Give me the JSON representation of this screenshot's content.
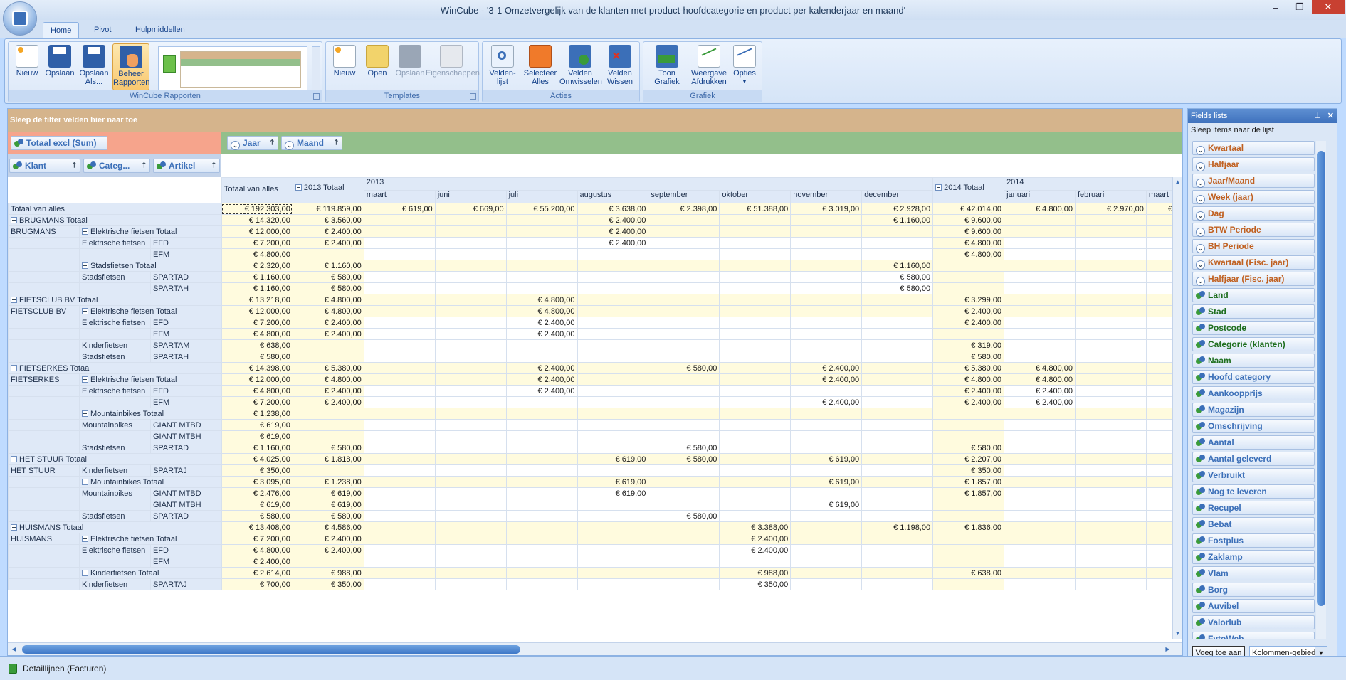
{
  "window": {
    "title": "WinCube - '3-1 Omzetvergelijk van de klanten met product-hoofdcategorie en product per kalenderjaar en maand'"
  },
  "tabs": [
    "Home",
    "Pivot",
    "Hulpmiddellen"
  ],
  "ribbon": {
    "groups": {
      "rapporten": "WinCube Rapporten",
      "templates": "Templates",
      "acties": "Acties",
      "grafiek": "Grafiek"
    },
    "buttons": {
      "nieuw": "Nieuw",
      "opslaan": "Opslaan",
      "opslaan_als": "Opslaan Als...",
      "beheer": "Beheer Rapporten",
      "t_nieuw": "Nieuw",
      "t_open": "Open",
      "t_opslaan": "Opslaan",
      "t_eigen": "Eigenschappen",
      "velden_lijst": "Velden-lijst",
      "selecteer_alles": "Selecteer Alles",
      "velden_omwisselen": "Velden Omwisselen",
      "velden_wissen": "Velden Wissen",
      "toon_grafiek": "Toon Grafiek",
      "weergave": "Weergave Afdrukken",
      "opties": "Opties"
    }
  },
  "pivot": {
    "filter_zone": "Sleep de filter velden hier naar toe",
    "data_field": "Totaal excl (Sum)",
    "col_fields": [
      "Jaar",
      "Maand"
    ],
    "row_fields": [
      "Klant",
      "Categ...",
      "Artikel"
    ],
    "headers": {
      "grand": "Totaal van alles",
      "y2013": "2013",
      "y2013_total": "2013 Totaal",
      "y2014": "2014",
      "y2014_total": "2014 Totaal",
      "months2013": [
        "maart",
        "juni",
        "juli",
        "augustus",
        "september",
        "oktober",
        "november",
        "december"
      ],
      "months2014": [
        "januari",
        "februari",
        "maart"
      ]
    },
    "rows": [
      {
        "type": "grand",
        "c1": "Totaal van alles",
        "c2": "",
        "c3": "",
        "vals": [
          "€ 192.303,00",
          "€ 119.859,00",
          "€ 619,00",
          "€ 669,00",
          "€ 55.200,00",
          "€ 3.638,00",
          "€ 2.398,00",
          "€ 51.388,00",
          "€ 3.019,00",
          "€ 2.928,00",
          "€ 42.014,00",
          "€ 4.800,00",
          "€ 2.970,00",
          "€"
        ]
      },
      {
        "type": "ctot",
        "c1": "BRUGMANS Totaal",
        "c2": "",
        "c3": "",
        "vals": [
          "€ 14.320,00",
          "€ 3.560,00",
          "",
          "",
          "",
          "€ 2.400,00",
          "",
          "",
          "",
          "€ 1.160,00",
          "€ 9.600,00",
          "",
          "",
          ""
        ]
      },
      {
        "type": "stot",
        "c1": "BRUGMANS",
        "c2": "Elektrische fietsen Totaal",
        "c3": "",
        "vals": [
          "€ 12.000,00",
          "€ 2.400,00",
          "",
          "",
          "",
          "€ 2.400,00",
          "",
          "",
          "",
          "",
          "€ 9.600,00",
          "",
          "",
          ""
        ]
      },
      {
        "type": "d",
        "c1": "",
        "c2": "Elektrische fietsen",
        "c3": "EFD",
        "vals": [
          "€ 7.200,00",
          "€ 2.400,00",
          "",
          "",
          "",
          "€ 2.400,00",
          "",
          "",
          "",
          "",
          "€ 4.800,00",
          "",
          "",
          ""
        ]
      },
      {
        "type": "d",
        "c1": "",
        "c2": "",
        "c3": "EFM",
        "vals": [
          "€ 4.800,00",
          "",
          "",
          "",
          "",
          "",
          "",
          "",
          "",
          "",
          "€ 4.800,00",
          "",
          "",
          ""
        ]
      },
      {
        "type": "stot",
        "c1": "",
        "c2": "Stadsfietsen Totaal",
        "c3": "",
        "vals": [
          "€ 2.320,00",
          "€ 1.160,00",
          "",
          "",
          "",
          "",
          "",
          "",
          "",
          "€ 1.160,00",
          "",
          "",
          "",
          ""
        ]
      },
      {
        "type": "d",
        "c1": "",
        "c2": "Stadsfietsen",
        "c3": "SPARTAD",
        "vals": [
          "€ 1.160,00",
          "€ 580,00",
          "",
          "",
          "",
          "",
          "",
          "",
          "",
          "€ 580,00",
          "",
          "",
          "",
          ""
        ]
      },
      {
        "type": "d",
        "c1": "",
        "c2": "",
        "c3": "SPARTAH",
        "vals": [
          "€ 1.160,00",
          "€ 580,00",
          "",
          "",
          "",
          "",
          "",
          "",
          "",
          "€ 580,00",
          "",
          "",
          "",
          ""
        ]
      },
      {
        "type": "ctot",
        "c1": "FIETSCLUB BV Totaal",
        "c2": "",
        "c3": "",
        "vals": [
          "€ 13.218,00",
          "€ 4.800,00",
          "",
          "",
          "€ 4.800,00",
          "",
          "",
          "",
          "",
          "",
          "€ 3.299,00",
          "",
          "",
          ""
        ]
      },
      {
        "type": "stot",
        "c1": "FIETSCLUB BV",
        "c2": "Elektrische fietsen Totaal",
        "c3": "",
        "vals": [
          "€ 12.000,00",
          "€ 4.800,00",
          "",
          "",
          "€ 4.800,00",
          "",
          "",
          "",
          "",
          "",
          "€ 2.400,00",
          "",
          "",
          ""
        ]
      },
      {
        "type": "d",
        "c1": "",
        "c2": "Elektrische fietsen",
        "c3": "EFD",
        "vals": [
          "€ 7.200,00",
          "€ 2.400,00",
          "",
          "",
          "€ 2.400,00",
          "",
          "",
          "",
          "",
          "",
          "€ 2.400,00",
          "",
          "",
          ""
        ]
      },
      {
        "type": "d",
        "c1": "",
        "c2": "",
        "c3": "EFM",
        "vals": [
          "€ 4.800,00",
          "€ 2.400,00",
          "",
          "",
          "€ 2.400,00",
          "",
          "",
          "",
          "",
          "",
          "",
          "",
          "",
          ""
        ]
      },
      {
        "type": "d",
        "c1": "",
        "c2": "Kinderfietsen",
        "c3": "SPARTAM",
        "vals": [
          "€ 638,00",
          "",
          "",
          "",
          "",
          "",
          "",
          "",
          "",
          "",
          "€ 319,00",
          "",
          "",
          ""
        ]
      },
      {
        "type": "d",
        "c1": "",
        "c2": "Stadsfietsen",
        "c3": "SPARTAH",
        "vals": [
          "€ 580,00",
          "",
          "",
          "",
          "",
          "",
          "",
          "",
          "",
          "",
          "€ 580,00",
          "",
          "",
          ""
        ]
      },
      {
        "type": "ctot",
        "c1": "FIETSERKES Totaal",
        "c2": "",
        "c3": "",
        "vals": [
          "€ 14.398,00",
          "€ 5.380,00",
          "",
          "",
          "€ 2.400,00",
          "",
          "€ 580,00",
          "",
          "€ 2.400,00",
          "",
          "€ 5.380,00",
          "€ 4.800,00",
          "",
          ""
        ]
      },
      {
        "type": "stot",
        "c1": "FIETSERKES",
        "c2": "Elektrische fietsen Totaal",
        "c3": "",
        "vals": [
          "€ 12.000,00",
          "€ 4.800,00",
          "",
          "",
          "€ 2.400,00",
          "",
          "",
          "",
          "€ 2.400,00",
          "",
          "€ 4.800,00",
          "€ 4.800,00",
          "",
          ""
        ]
      },
      {
        "type": "d",
        "c1": "",
        "c2": "Elektrische fietsen",
        "c3": "EFD",
        "vals": [
          "€ 4.800,00",
          "€ 2.400,00",
          "",
          "",
          "€ 2.400,00",
          "",
          "",
          "",
          "",
          "",
          "€ 2.400,00",
          "€ 2.400,00",
          "",
          ""
        ]
      },
      {
        "type": "d",
        "c1": "",
        "c2": "",
        "c3": "EFM",
        "vals": [
          "€ 7.200,00",
          "€ 2.400,00",
          "",
          "",
          "",
          "",
          "",
          "",
          "€ 2.400,00",
          "",
          "€ 2.400,00",
          "€ 2.400,00",
          "",
          ""
        ]
      },
      {
        "type": "stot",
        "c1": "",
        "c2": "Mountainbikes Totaal",
        "c3": "",
        "vals": [
          "€ 1.238,00",
          "",
          "",
          "",
          "",
          "",
          "",
          "",
          "",
          "",
          "",
          "",
          "",
          ""
        ]
      },
      {
        "type": "d",
        "c1": "",
        "c2": "Mountainbikes",
        "c3": "GIANT MTBD",
        "vals": [
          "€ 619,00",
          "",
          "",
          "",
          "",
          "",
          "",
          "",
          "",
          "",
          "",
          "",
          "",
          ""
        ]
      },
      {
        "type": "d",
        "c1": "",
        "c2": "",
        "c3": "GIANT MTBH",
        "vals": [
          "€ 619,00",
          "",
          "",
          "",
          "",
          "",
          "",
          "",
          "",
          "",
          "",
          "",
          "",
          ""
        ]
      },
      {
        "type": "d",
        "c1": "",
        "c2": "Stadsfietsen",
        "c3": "SPARTAD",
        "vals": [
          "€ 1.160,00",
          "€ 580,00",
          "",
          "",
          "",
          "",
          "€ 580,00",
          "",
          "",
          "",
          "€ 580,00",
          "",
          "",
          ""
        ]
      },
      {
        "type": "ctot",
        "c1": "HET STUUR Totaal",
        "c2": "",
        "c3": "",
        "vals": [
          "€ 4.025,00",
          "€ 1.818,00",
          "",
          "",
          "",
          "€ 619,00",
          "€ 580,00",
          "",
          "€ 619,00",
          "",
          "€ 2.207,00",
          "",
          "",
          ""
        ]
      },
      {
        "type": "d",
        "c1": "HET STUUR",
        "c2": "Kinderfietsen",
        "c3": "SPARTAJ",
        "vals": [
          "€ 350,00",
          "",
          "",
          "",
          "",
          "",
          "",
          "",
          "",
          "",
          "€ 350,00",
          "",
          "",
          ""
        ]
      },
      {
        "type": "stot",
        "c1": "",
        "c2": "Mountainbikes Totaal",
        "c3": "",
        "vals": [
          "€ 3.095,00",
          "€ 1.238,00",
          "",
          "",
          "",
          "€ 619,00",
          "",
          "",
          "€ 619,00",
          "",
          "€ 1.857,00",
          "",
          "",
          ""
        ]
      },
      {
        "type": "d",
        "c1": "",
        "c2": "Mountainbikes",
        "c3": "GIANT MTBD",
        "vals": [
          "€ 2.476,00",
          "€ 619,00",
          "",
          "",
          "",
          "€ 619,00",
          "",
          "",
          "",
          "",
          "€ 1.857,00",
          "",
          "",
          ""
        ]
      },
      {
        "type": "d",
        "c1": "",
        "c2": "",
        "c3": "GIANT MTBH",
        "vals": [
          "€ 619,00",
          "€ 619,00",
          "",
          "",
          "",
          "",
          "",
          "",
          "€ 619,00",
          "",
          "",
          "",
          "",
          ""
        ]
      },
      {
        "type": "d",
        "c1": "",
        "c2": "Stadsfietsen",
        "c3": "SPARTAD",
        "vals": [
          "€ 580,00",
          "€ 580,00",
          "",
          "",
          "",
          "",
          "€ 580,00",
          "",
          "",
          "",
          "",
          "",
          "",
          ""
        ]
      },
      {
        "type": "ctot",
        "c1": "HUISMANS Totaal",
        "c2": "",
        "c3": "",
        "vals": [
          "€ 13.408,00",
          "€ 4.586,00",
          "",
          "",
          "",
          "",
          "",
          "€ 3.388,00",
          "",
          "€ 1.198,00",
          "€ 1.836,00",
          "",
          "",
          ""
        ]
      },
      {
        "type": "stot",
        "c1": "HUISMANS",
        "c2": "Elektrische fietsen Totaal",
        "c3": "",
        "vals": [
          "€ 7.200,00",
          "€ 2.400,00",
          "",
          "",
          "",
          "",
          "",
          "€ 2.400,00",
          "",
          "",
          "",
          "",
          "",
          ""
        ]
      },
      {
        "type": "d",
        "c1": "",
        "c2": "Elektrische fietsen",
        "c3": "EFD",
        "vals": [
          "€ 4.800,00",
          "€ 2.400,00",
          "",
          "",
          "",
          "",
          "",
          "€ 2.400,00",
          "",
          "",
          "",
          "",
          "",
          ""
        ]
      },
      {
        "type": "d",
        "c1": "",
        "c2": "",
        "c3": "EFM",
        "vals": [
          "€ 2.400,00",
          "",
          "",
          "",
          "",
          "",
          "",
          "",
          "",
          "",
          "",
          "",
          "",
          ""
        ]
      },
      {
        "type": "stot",
        "c1": "",
        "c2": "Kinderfietsen Totaal",
        "c3": "",
        "vals": [
          "€ 2.614,00",
          "€ 988,00",
          "",
          "",
          "",
          "",
          "",
          "€ 988,00",
          "",
          "",
          "€ 638,00",
          "",
          "",
          ""
        ]
      },
      {
        "type": "d",
        "c1": "",
        "c2": "Kinderfietsen",
        "c3": "SPARTAJ",
        "vals": [
          "€ 700,00",
          "€ 350,00",
          "",
          "",
          "",
          "",
          "",
          "€ 350,00",
          "",
          "",
          "",
          "",
          "",
          ""
        ]
      }
    ]
  },
  "fields_panel": {
    "title": "Fields lists",
    "subtitle": "Sleep items naar de lijst",
    "items": [
      {
        "label": "Kwartaal",
        "kind": "t"
      },
      {
        "label": "Halfjaar",
        "kind": "t"
      },
      {
        "label": "Jaar/Maand",
        "kind": "t"
      },
      {
        "label": "Week (jaar)",
        "kind": "t"
      },
      {
        "label": "Dag",
        "kind": "t"
      },
      {
        "label": "BTW Periode",
        "kind": "t"
      },
      {
        "label": "BH Periode",
        "kind": "t"
      },
      {
        "label": "Kwartaal (Fisc. jaar)",
        "kind": "t"
      },
      {
        "label": "Halfjaar (Fisc. jaar)",
        "kind": "t"
      },
      {
        "label": "Land",
        "kind": "g"
      },
      {
        "label": "Stad",
        "kind": "g"
      },
      {
        "label": "Postcode",
        "kind": "g"
      },
      {
        "label": "Categorie (klanten)",
        "kind": "g"
      },
      {
        "label": "Naam",
        "kind": "g"
      },
      {
        "label": "Hoofd category",
        "kind": "b"
      },
      {
        "label": "Aankoopprijs",
        "kind": "b"
      },
      {
        "label": "Magazijn",
        "kind": "b"
      },
      {
        "label": "Omschrijving",
        "kind": "b"
      },
      {
        "label": "Aantal",
        "kind": "b"
      },
      {
        "label": "Aantal geleverd",
        "kind": "b"
      },
      {
        "label": "Verbruikt",
        "kind": "b"
      },
      {
        "label": "Nog te leveren",
        "kind": "b"
      },
      {
        "label": "Recupel",
        "kind": "b"
      },
      {
        "label": "Bebat",
        "kind": "b"
      },
      {
        "label": "Fostplus",
        "kind": "b"
      },
      {
        "label": "Zaklamp",
        "kind": "b"
      },
      {
        "label": "Vlam",
        "kind": "b"
      },
      {
        "label": "Borg",
        "kind": "b"
      },
      {
        "label": "Auvibel",
        "kind": "b"
      },
      {
        "label": "Valorlub",
        "kind": "b"
      },
      {
        "label": "FytoWeb",
        "kind": "b"
      }
    ],
    "add_button": "Voeg toe aan",
    "area_select": "Kolommen-gebied"
  },
  "status": {
    "text": "Detaillijnen (Facturen)"
  }
}
